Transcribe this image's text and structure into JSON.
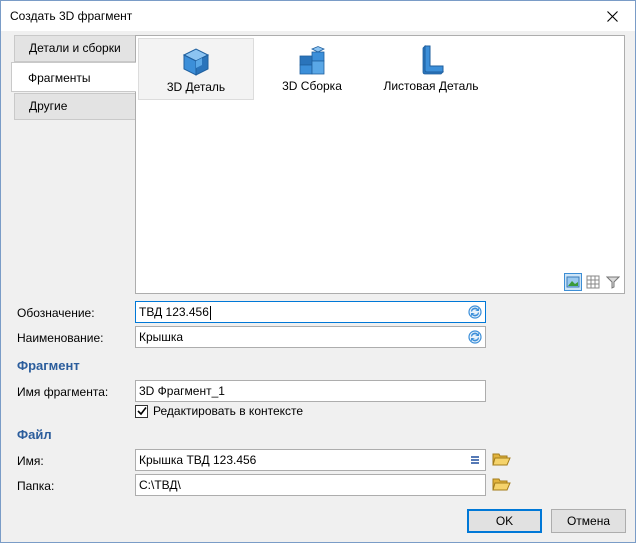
{
  "window": {
    "title": "Создать 3D фрагмент"
  },
  "tabs": [
    {
      "label": "Детали и сборки"
    },
    {
      "label": "Фрагменты"
    },
    {
      "label": "Другие"
    }
  ],
  "templates": [
    {
      "label": "3D Деталь",
      "icon": "part-icon"
    },
    {
      "label": "3D Сборка",
      "icon": "assembly-icon"
    },
    {
      "label": "Листовая Деталь",
      "icon": "sheet-metal-icon"
    }
  ],
  "view_buttons": [
    "large-icons-view-icon",
    "list-view-icon",
    "filter-icon"
  ],
  "designation": {
    "label": "Обозначение:",
    "value": "ТВД 123.456"
  },
  "name": {
    "label": "Наименование:",
    "value": "Крышка"
  },
  "fragment": {
    "heading": "Фрагмент",
    "name_label": "Имя фрагмента:",
    "name_value": "3D Фрагмент_1",
    "edit_in_context_label": "Редактировать в контексте",
    "edit_in_context_checked": true
  },
  "file": {
    "heading": "Файл",
    "name_label": "Имя:",
    "name_value": "Крышка ТВД 123.456",
    "folder_label": "Папка:",
    "folder_value": "C:\\ТВД\\"
  },
  "buttons": {
    "ok": "OK",
    "cancel": "Отмена"
  },
  "colors": {
    "accent": "#2b5d9c",
    "icon_blue": "#3c8fd9",
    "focus": "#0078d7"
  }
}
